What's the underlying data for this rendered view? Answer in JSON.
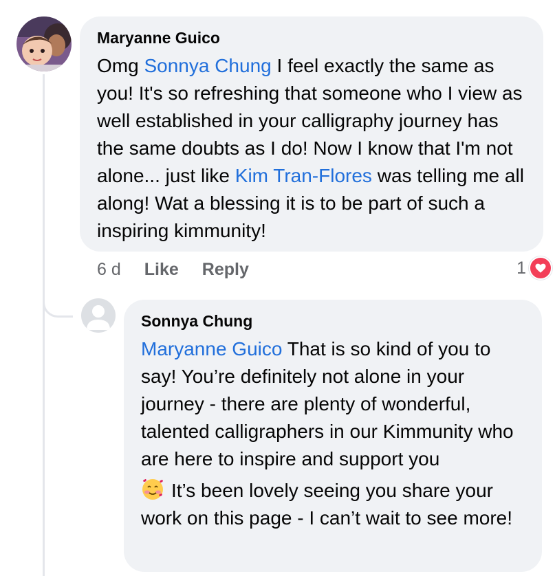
{
  "colors": {
    "mention": "#216fdb",
    "bubble": "#f0f2f5",
    "meta": "#65676b",
    "heart": "#f33e58"
  },
  "comment": {
    "author": "Maryanne Guico",
    "text": {
      "seg1": "Omg ",
      "mention1": "Sonnya Chung",
      "seg2": " I feel exactly the same as you! It's so refreshing that someone who I view as well established in your calligraphy journey has the same doubts as I do! Now I know that I'm not alone... just like ",
      "mention2": "Kim Tran-Flores",
      "seg3": " was telling me all along! Wat a blessing it is to be part of such a inspiring kimmunity!"
    },
    "time": "6 d",
    "like_label": "Like",
    "reply_label": "Reply",
    "reaction_count": "1",
    "reaction_icon": "heart-icon"
  },
  "reply": {
    "author": "Sonnya Chung",
    "text": {
      "mention": "Maryanne Guico",
      "seg1": " That is so kind of you to say! You’re definitely not alone in your journey - there are plenty of wonderful, talented calligraphers in our Kimmunity who are here to inspire and support you",
      "emoji": "smiling-face-with-hearts-icon",
      "seg2": "It’s been lovely seeing you share your work on this page - I can’t wait to see more!"
    }
  }
}
